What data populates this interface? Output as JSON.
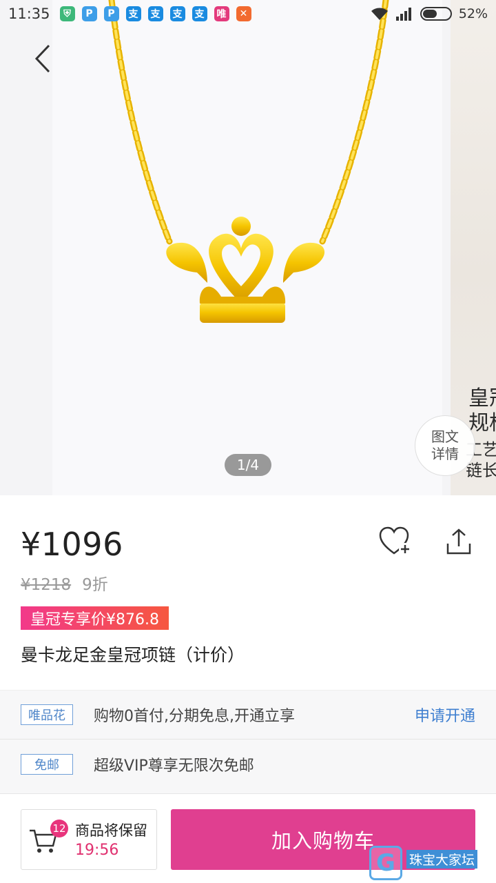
{
  "status_bar": {
    "time": "11:35",
    "battery": "52%",
    "notifications": [
      {
        "glyph": "⛨",
        "color": "#3db87a",
        "name": "shield-notification-icon"
      },
      {
        "glyph": "P",
        "color": "#3d9ee8",
        "name": "chat-notification-icon"
      },
      {
        "glyph": "P",
        "color": "#3d9ee8",
        "name": "chat-notification-icon-2"
      },
      {
        "glyph": "支",
        "color": "#1a8be0",
        "name": "alipay-notification-icon"
      },
      {
        "glyph": "支",
        "color": "#1a8be0",
        "name": "alipay-notification-icon-2"
      },
      {
        "glyph": "支",
        "color": "#1a8be0",
        "name": "alipay-notification-icon-3"
      },
      {
        "glyph": "支",
        "color": "#1a8be0",
        "name": "alipay-notification-icon-4"
      },
      {
        "glyph": "唯",
        "color": "#e33a7c",
        "name": "vip-notification-icon"
      },
      {
        "glyph": "✕",
        "color": "#f26a2f",
        "name": "app-notification-icon"
      }
    ]
  },
  "gallery": {
    "counter": "1/4",
    "detail_button_line1": "图文",
    "detail_button_line2": "详情",
    "next_image_text_1": "皇冠",
    "next_image_text_2": "规格",
    "next_image_text_3": "工艺",
    "next_image_text_4": "链长"
  },
  "product": {
    "price": "¥1096",
    "original_price": "¥1218",
    "discount": "9折",
    "vip_price": "皇冠专享价¥876.8",
    "title": "曼卡龙足金皇冠项链（计价）"
  },
  "info_rows": {
    "installment_tag": "唯品花",
    "installment_text": "购物0首付,分期免息,开通立享",
    "installment_action": "申请开通",
    "shipping_tag": "免邮",
    "shipping_text": "超级VIP尊享无限次免邮"
  },
  "bottom_bar": {
    "cart_count": "12",
    "cart_label": "商品将保留",
    "cart_timer": "19:56",
    "add_to_cart": "加入购物车"
  },
  "watermark": {
    "logo": "G",
    "text": "珠宝大家坛"
  },
  "colors": {
    "accent": "#e03f90",
    "link": "#3f7fd0",
    "gold": "#f2c200"
  }
}
